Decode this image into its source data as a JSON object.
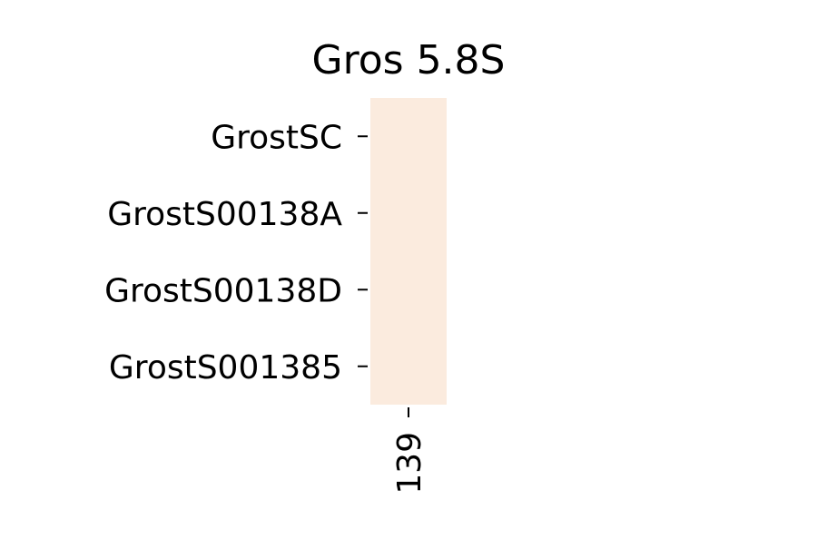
{
  "chart_data": {
    "type": "heatmap",
    "title": "Gros 5.8S",
    "xlabel": "",
    "ylabel": "",
    "x_categories": [
      "139"
    ],
    "y_categories": [
      "GrostSC",
      "GrostS00138A",
      "GrostS00138D",
      "GrostS001385"
    ],
    "cell_color": "#fbebde",
    "values": [
      [
        null
      ],
      [
        null
      ],
      [
        null
      ],
      [
        null
      ]
    ],
    "colorbar": false,
    "grid": false
  }
}
